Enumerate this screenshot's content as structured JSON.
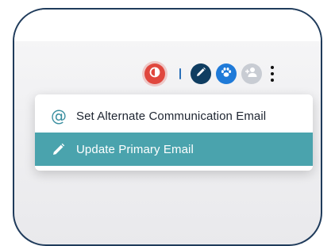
{
  "toolbar": {
    "icons": [
      "contrast-icon",
      "pencil-icon",
      "paw-icon",
      "add-user-icon",
      "more-vert-icon"
    ]
  },
  "menu": {
    "items": [
      {
        "label": "Set Alternate Communication Email",
        "icon": "at-sign-icon",
        "selected": false
      },
      {
        "label": "Update Primary Email",
        "icon": "pencil-icon",
        "selected": true
      }
    ]
  },
  "colors": {
    "frame_border": "#1f3b5b",
    "contrast_button": "#e0473e",
    "edit_button": "#0f3d61",
    "pets_button": "#1f7ad8",
    "users_button": "#c8ccd3",
    "selected_item": "#4aa3ad",
    "at_icon": "#3a8fa0"
  }
}
